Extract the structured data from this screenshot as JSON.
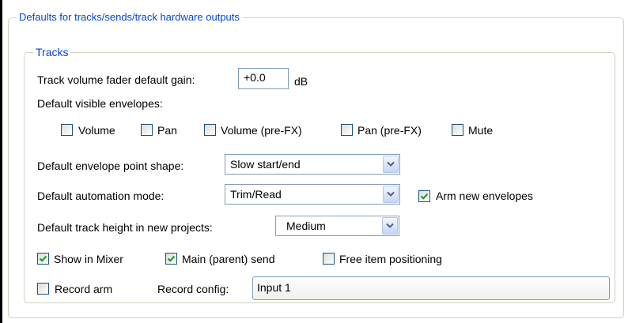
{
  "groups": {
    "outer_title": "Defaults for tracks/sends/track hardware outputs",
    "inner_title": "Tracks"
  },
  "volume_gain": {
    "label": "Track volume fader default gain:",
    "value": "+0.0",
    "unit": "dB"
  },
  "visible_envelopes": {
    "label": "Default visible envelopes:",
    "items": [
      {
        "label": "Volume",
        "checked": false
      },
      {
        "label": "Pan",
        "checked": false
      },
      {
        "label": "Volume (pre-FX)",
        "checked": false
      },
      {
        "label": "Pan (pre-FX)",
        "checked": false
      },
      {
        "label": "Mute",
        "checked": false
      }
    ]
  },
  "point_shape": {
    "label": "Default envelope point shape:",
    "value": "Slow start/end"
  },
  "automation_mode": {
    "label": "Default automation mode:",
    "value": "Trim/Read"
  },
  "arm_new_envelopes": {
    "label": "Arm new envelopes",
    "checked": true
  },
  "track_height": {
    "label": "Default track height in new projects:",
    "value": "Medium"
  },
  "options": {
    "show_in_mixer": {
      "label": "Show in Mixer",
      "checked": true
    },
    "main_send": {
      "label": "Main (parent) send",
      "checked": true
    },
    "free_positioning": {
      "label": "Free item positioning",
      "checked": false
    }
  },
  "record": {
    "arm": {
      "label": "Record arm",
      "checked": false
    },
    "config_label": "Record config:",
    "config_value": "Input 1"
  },
  "colors": {
    "group_title": "#0046d5",
    "checkmark": "#21a121",
    "field_border": "#7f9db9"
  }
}
